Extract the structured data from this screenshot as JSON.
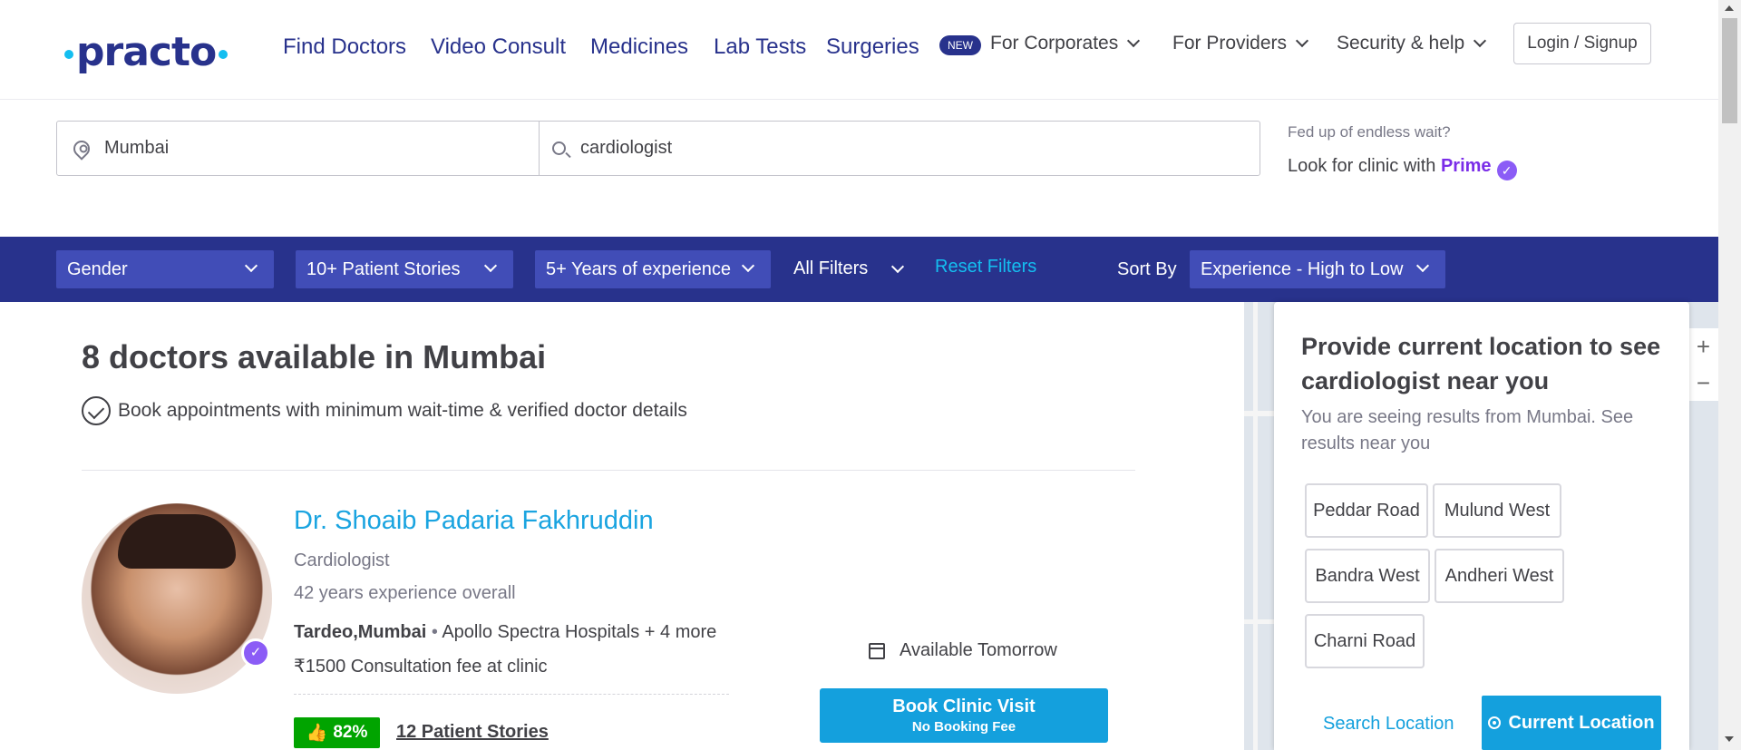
{
  "nav": {
    "logo": "practo",
    "main_links": [
      "Find Doctors",
      "Video Consult",
      "Medicines",
      "Lab Tests",
      "Surgeries"
    ],
    "new_badge": "NEW",
    "corporates": "For Corporates",
    "providers": "For Providers",
    "security": "Security & help",
    "login": "Login / Signup"
  },
  "search": {
    "location_value": "Mumbai",
    "query_value": "cardiologist"
  },
  "prime": {
    "tagline": "Fed up of endless wait?",
    "text": "Look for clinic with ",
    "brand": "Prime",
    "check": "✓"
  },
  "filters": {
    "gender": "Gender",
    "stories": "10+ Patient Stories",
    "experience": "5+ Years of experience",
    "all_filters": "All Filters",
    "reset": "Reset Filters",
    "sort_label": "Sort By",
    "sort_value": "Experience - High to Low"
  },
  "results": {
    "heading": "8 doctors available in Mumbai",
    "subheading": "Book appointments with minimum wait-time & verified doctor details"
  },
  "doctor": {
    "name": "Dr. Shoaib Padaria Fakhruddin",
    "specialty": "Cardiologist",
    "experience": "42 years experience overall",
    "locality": "Tardeo,Mumbai",
    "separator": "•",
    "clinic": "Apollo Spectra Hospitals + 4 more",
    "fee": "₹1500 Consultation fee at clinic",
    "rating": "82%",
    "stories": "12 Patient Stories",
    "availability": "Available Tomorrow",
    "book_label": "Book Clinic Visit",
    "book_sub": "No Booking Fee",
    "verified": "✓"
  },
  "location_panel": {
    "title": "Provide current location to see cardiologist near you",
    "subtitle": "You are seeing results from Mumbai. See results near you",
    "chips": [
      "Peddar Road",
      "Mulund West",
      "Bandra West",
      "Andheri West",
      "Charni Road"
    ],
    "search_location": "Search Location",
    "current_location": "Current Location"
  },
  "map": {
    "zoom_in": "+",
    "zoom_out": "−"
  },
  "colors": {
    "brand_navy": "#28328c",
    "accent_blue": "#14a0dd",
    "prime_purple": "#7b2ee8",
    "rating_green": "#01a400"
  }
}
